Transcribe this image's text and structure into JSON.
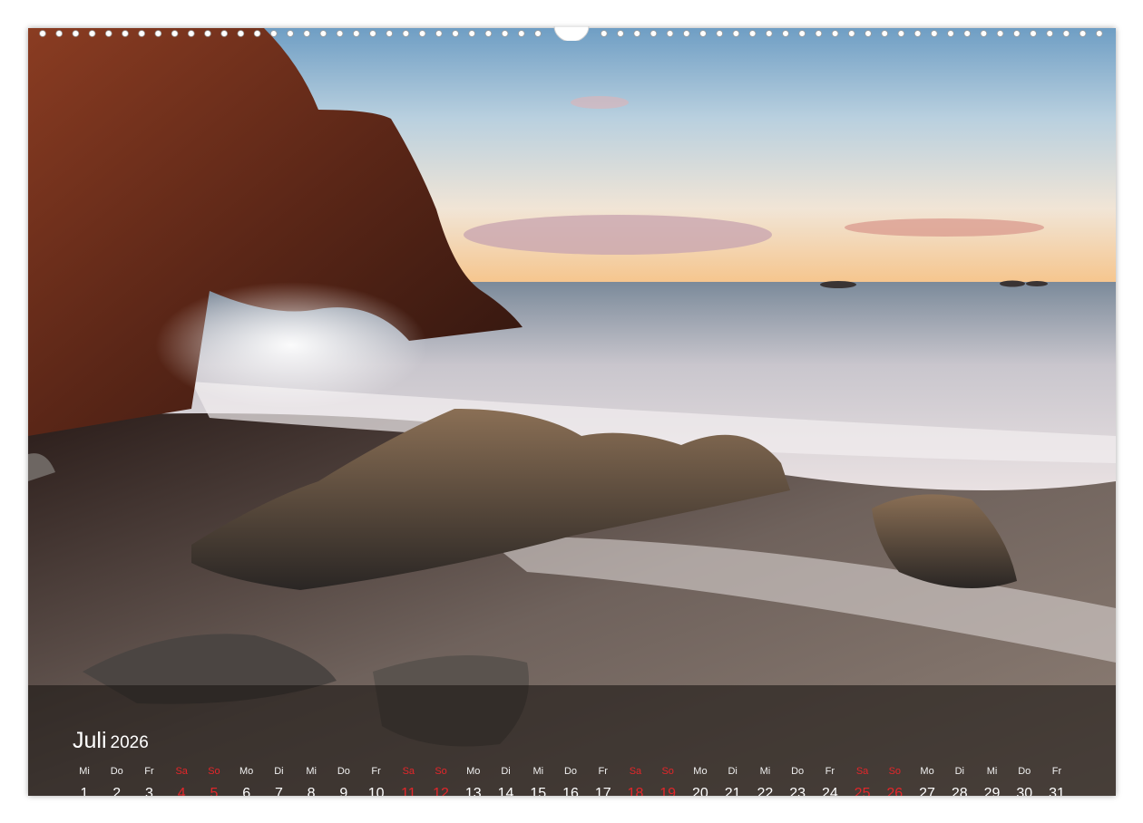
{
  "calendar": {
    "month": "Juli",
    "year": "2026",
    "weekend_color": "#e3262a",
    "days": [
      {
        "weekday": "Mi",
        "day": "1",
        "weekend": false
      },
      {
        "weekday": "Do",
        "day": "2",
        "weekend": false
      },
      {
        "weekday": "Fr",
        "day": "3",
        "weekend": false
      },
      {
        "weekday": "Sa",
        "day": "4",
        "weekend": true
      },
      {
        "weekday": "So",
        "day": "5",
        "weekend": true
      },
      {
        "weekday": "Mo",
        "day": "6",
        "weekend": false
      },
      {
        "weekday": "Di",
        "day": "7",
        "weekend": false
      },
      {
        "weekday": "Mi",
        "day": "8",
        "weekend": false
      },
      {
        "weekday": "Do",
        "day": "9",
        "weekend": false
      },
      {
        "weekday": "Fr",
        "day": "10",
        "weekend": false
      },
      {
        "weekday": "Sa",
        "day": "11",
        "weekend": true
      },
      {
        "weekday": "So",
        "day": "12",
        "weekend": true
      },
      {
        "weekday": "Mo",
        "day": "13",
        "weekend": false
      },
      {
        "weekday": "Di",
        "day": "14",
        "weekend": false
      },
      {
        "weekday": "Mi",
        "day": "15",
        "weekend": false
      },
      {
        "weekday": "Do",
        "day": "16",
        "weekend": false
      },
      {
        "weekday": "Fr",
        "day": "17",
        "weekend": false
      },
      {
        "weekday": "Sa",
        "day": "18",
        "weekend": true
      },
      {
        "weekday": "So",
        "day": "19",
        "weekend": true
      },
      {
        "weekday": "Mo",
        "day": "20",
        "weekend": false
      },
      {
        "weekday": "Di",
        "day": "21",
        "weekend": false
      },
      {
        "weekday": "Mi",
        "day": "22",
        "weekend": false
      },
      {
        "weekday": "Do",
        "day": "23",
        "weekend": false
      },
      {
        "weekday": "Fr",
        "day": "24",
        "weekend": false
      },
      {
        "weekday": "Sa",
        "day": "25",
        "weekend": true
      },
      {
        "weekday": "So",
        "day": "26",
        "weekend": true
      },
      {
        "weekday": "Mo",
        "day": "27",
        "weekend": false
      },
      {
        "weekday": "Di",
        "day": "28",
        "weekend": false
      },
      {
        "weekday": "Mi",
        "day": "29",
        "weekend": false
      },
      {
        "weekday": "Do",
        "day": "30",
        "weekend": false
      },
      {
        "weekday": "Fr",
        "day": "31",
        "weekend": false
      }
    ]
  }
}
